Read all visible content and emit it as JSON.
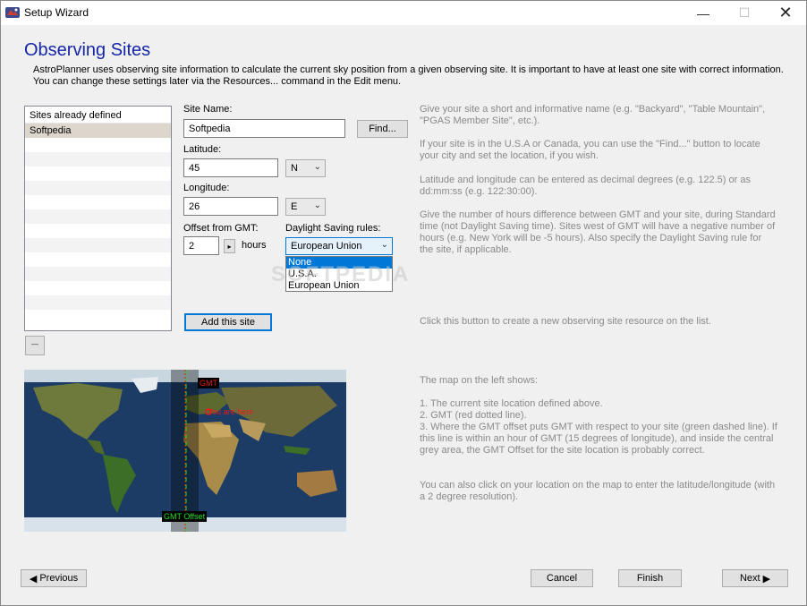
{
  "window": {
    "title": "Setup Wizard",
    "minimize_glyph": "—",
    "maximize_glyph": "☐",
    "close_glyph": "✕"
  },
  "page": {
    "heading": "Observing Sites",
    "intro": "AstroPlanner uses observing site information to calculate the current sky position from a given observing site. It is important to have at least one site with correct information. You can change these settings later via the Resources... command in the Edit menu."
  },
  "sites": {
    "header": "Sites already defined",
    "items": [
      "Softpedia"
    ],
    "remove_label": "−"
  },
  "form": {
    "site_name_label": "Site Name:",
    "site_name_value": "Softpedia",
    "find_button": "Find...",
    "latitude_label": "Latitude:",
    "latitude_value": "45",
    "latitude_dir": "N",
    "longitude_label": "Longitude:",
    "longitude_value": "26",
    "longitude_dir": "E",
    "offset_label": "Offset from GMT:",
    "offset_value": "2",
    "offset_spin": "▸",
    "hours_label": "hours",
    "dst_label": "Daylight Saving rules:",
    "dst_value": "European Union",
    "dst_options": [
      "None",
      "U.S.A.",
      "European Union"
    ],
    "add_button": "Add this site"
  },
  "help": {
    "p1": "Give your site a short and informative name (e.g. \"Backyard\", \"Table Mountain\", \"PGAS Member Site\", etc.).",
    "p2": "If your site is in the U.S.A or Canada, you can use the \"Find...\" button to locate your city and set the location, if you wish.",
    "p3": "Latitude and longitude can be entered as decimal degrees (e.g. 122.5) or as dd:mm:ss (e.g. 122:30:00).",
    "p4": "Give the number of hours difference between GMT and your site, during Standard time (not Daylight Saving time). Sites west of GMT will have a negative number of hours (e.g. New York will be -5 hours). Also specify the Daylight Saving rule for the site, if applicable.",
    "p5": "Click this button to create a new observing site resource on the list.",
    "p6": "The map on the left shows:",
    "p7": "1. The current site location defined above.",
    "p8": "2. GMT (red dotted line).",
    "p9": "3. Where the GMT offset puts GMT with respect to your site (green dashed line). If this line is within an hour of GMT (15 degrees of longitude), and inside the central grey area, the GMT Offset for the site location is probably correct.",
    "p10": "You can also click on your location on the map to enter the latitude/longitude (with a 2 degree resolution)."
  },
  "map": {
    "gmt_label": "GMT",
    "offset_label": "GMT Offset",
    "here_label": "You are here"
  },
  "watermark": "SOFTPEDIA",
  "nav": {
    "previous": "Previous",
    "cancel": "Cancel",
    "finish": "Finish",
    "next": "Next"
  },
  "colors": {
    "heading": "#1526a8",
    "accent": "#0078d7",
    "gmt_line": "#e81a1a",
    "offset_line": "#22e022"
  }
}
